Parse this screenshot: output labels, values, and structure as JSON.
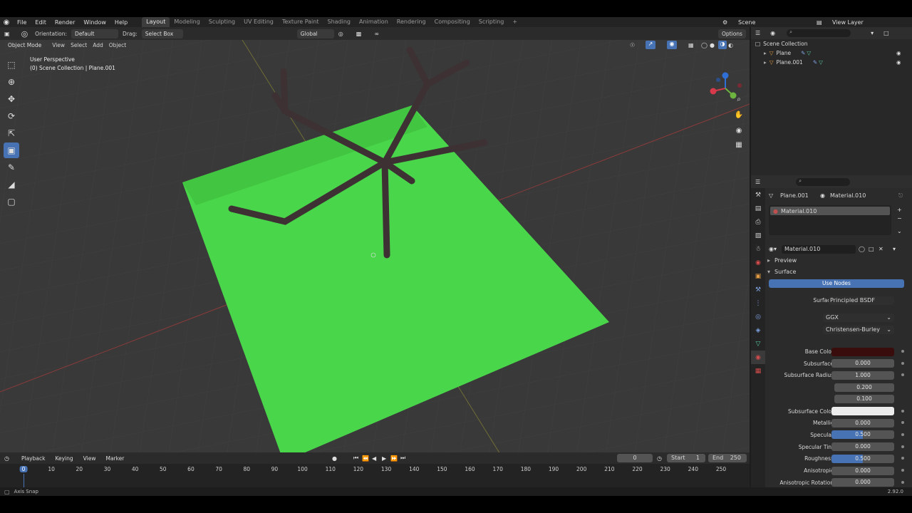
{
  "menus": [
    "File",
    "Edit",
    "Render",
    "Window",
    "Help"
  ],
  "workspaces": [
    "Layout",
    "Modeling",
    "Sculpting",
    "UV Editing",
    "Texture Paint",
    "Shading",
    "Animation",
    "Rendering",
    "Compositing",
    "Scripting"
  ],
  "active_workspace": "Layout",
  "scene": {
    "name": "Scene",
    "view_layer": "View Layer"
  },
  "header": {
    "orientation_label": "Orientation:",
    "orientation_value": "Default",
    "drag_label": "Drag:",
    "drag_value": "Select Box",
    "transform_value": "Global",
    "options_label": "Options",
    "mode_value": "Object Mode",
    "view_menus": [
      "View",
      "Select",
      "Add",
      "Object"
    ]
  },
  "viewport": {
    "perspective": "User Perspective",
    "collection": "(0) Scene Collection | Plane.001"
  },
  "outliner": {
    "root": "Scene Collection",
    "items": [
      {
        "name": "Plane"
      },
      {
        "name": "Plane.001"
      }
    ]
  },
  "properties": {
    "breadcrumb_object": "Plane.001",
    "breadcrumb_material": "Material.010",
    "slot_material": "Material.010",
    "material_name": "Material.010",
    "preview_label": "Preview",
    "surface_panel": "Surface",
    "use_nodes": "Use Nodes",
    "surface_label": "Surface",
    "surface_value": "Principled BSDF",
    "distribution": "GGX",
    "subsurface_method": "Christensen-Burley",
    "fields": [
      {
        "label": "Base Color",
        "value": "",
        "type": "color",
        "color": "#3a0d0d"
      },
      {
        "label": "Subsurface",
        "value": "0.000"
      },
      {
        "label": "Subsurface Radius",
        "value": "1.000"
      },
      {
        "label": "",
        "value": "0.200"
      },
      {
        "label": "",
        "value": "0.100"
      },
      {
        "label": "Subsurface Color",
        "value": "",
        "type": "color",
        "color": "#ececec"
      },
      {
        "label": "Metallic",
        "value": "0.000"
      },
      {
        "label": "Specular",
        "value": "0.500",
        "fill": 0.5
      },
      {
        "label": "Specular Tint",
        "value": "0.000"
      },
      {
        "label": "Roughness",
        "value": "0.500",
        "fill": 0.5
      },
      {
        "label": "Anisotropic",
        "value": "0.000"
      },
      {
        "label": "Anisotropic Rotation",
        "value": "0.000"
      }
    ]
  },
  "timeline": {
    "menus": [
      "Playback",
      "Keying",
      "View",
      "Marker"
    ],
    "current_frame": "0",
    "start_label": "Start",
    "start_value": "1",
    "end_label": "End",
    "end_value": "250",
    "ruler_marks": [
      "0",
      "10",
      "20",
      "30",
      "40",
      "50",
      "60",
      "70",
      "80",
      "90",
      "100",
      "110",
      "120",
      "130",
      "140",
      "150",
      "160",
      "170",
      "180",
      "190",
      "200",
      "210",
      "220",
      "230",
      "240",
      "250"
    ]
  },
  "status": {
    "left": "Axis Snap",
    "version": "2.92.0"
  },
  "colors": {
    "accent": "#4772b3",
    "grass": "#3fd23f",
    "background": "#393939"
  }
}
